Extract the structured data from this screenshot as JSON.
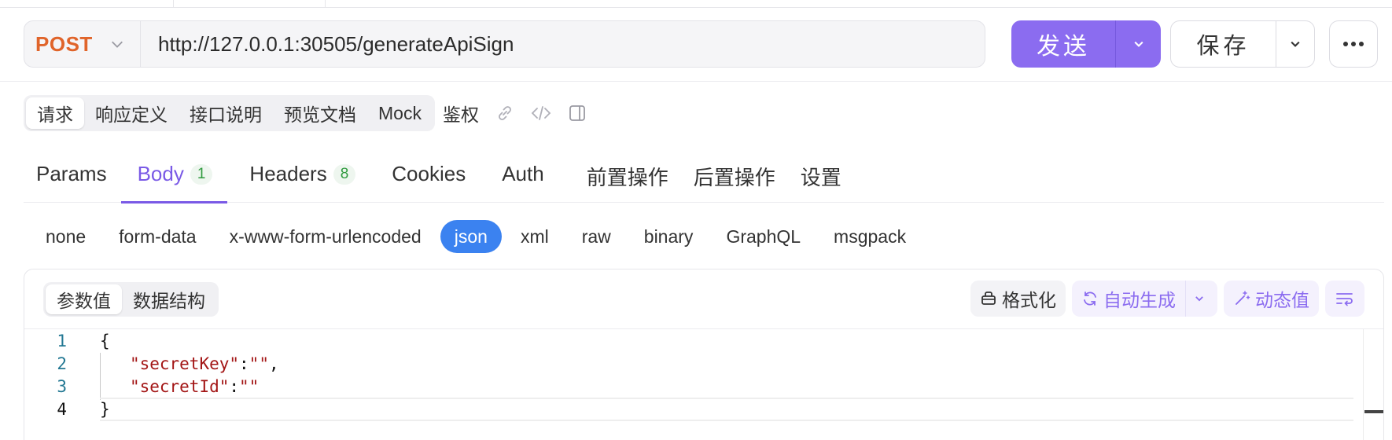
{
  "request": {
    "method": "POST",
    "url": "http://127.0.0.1:30505/generateApiSign",
    "send_label": "发送",
    "save_label": "保存"
  },
  "segments": {
    "items": [
      "请求",
      "响应定义",
      "接口说明",
      "预览文档",
      "Mock"
    ],
    "active": "请求",
    "extra": "鉴权"
  },
  "tabs": [
    {
      "label": "Params",
      "badge": ""
    },
    {
      "label": "Body",
      "badge": "1"
    },
    {
      "label": "Headers",
      "badge": "8"
    },
    {
      "label": "Cookies",
      "badge": ""
    },
    {
      "label": "Auth",
      "badge": ""
    },
    {
      "label": "前置操作",
      "badge": ""
    },
    {
      "label": "后置操作",
      "badge": ""
    },
    {
      "label": "设置",
      "badge": ""
    }
  ],
  "body_types": [
    "none",
    "form-data",
    "x-www-form-urlencoded",
    "json",
    "xml",
    "raw",
    "binary",
    "GraphQL",
    "msgpack"
  ],
  "active_body_type": "json",
  "editor": {
    "modes": [
      "参数值",
      "数据结构"
    ],
    "active_mode": "参数值",
    "format_label": "格式化",
    "autogen_label": "自动生成",
    "dynamic_label": "动态值",
    "line_numbers": [
      "1",
      "2",
      "3",
      "4"
    ]
  },
  "colors": {
    "accent": "#8b6cf0",
    "method": "#e0642a",
    "json_active": "#3b82f0",
    "badge": "#2f9a3e"
  }
}
